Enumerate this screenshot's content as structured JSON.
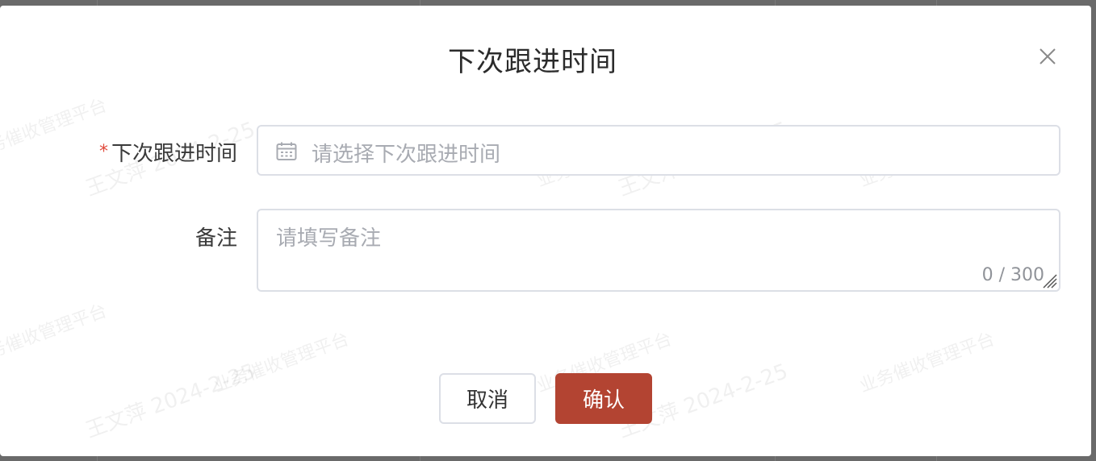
{
  "dialog": {
    "title": "下次跟进时间",
    "close_icon": "close-icon"
  },
  "form": {
    "next_followup": {
      "required_mark": "*",
      "label": "下次跟进时间",
      "placeholder": "请选择下次跟进时间",
      "icon": "calendar-icon"
    },
    "remark": {
      "label": "备注",
      "placeholder": "请填写备注",
      "counter": "0 / 300"
    }
  },
  "footer": {
    "cancel_label": "取消",
    "confirm_label": "确认"
  },
  "watermark": {
    "name_date": "王文萍 2024-2-25",
    "platform": "业务催收管理平台"
  },
  "colors": {
    "primary": "#b34432",
    "required": "#e0493b",
    "placeholder": "#a8abb2",
    "border": "#dcdfe6"
  }
}
